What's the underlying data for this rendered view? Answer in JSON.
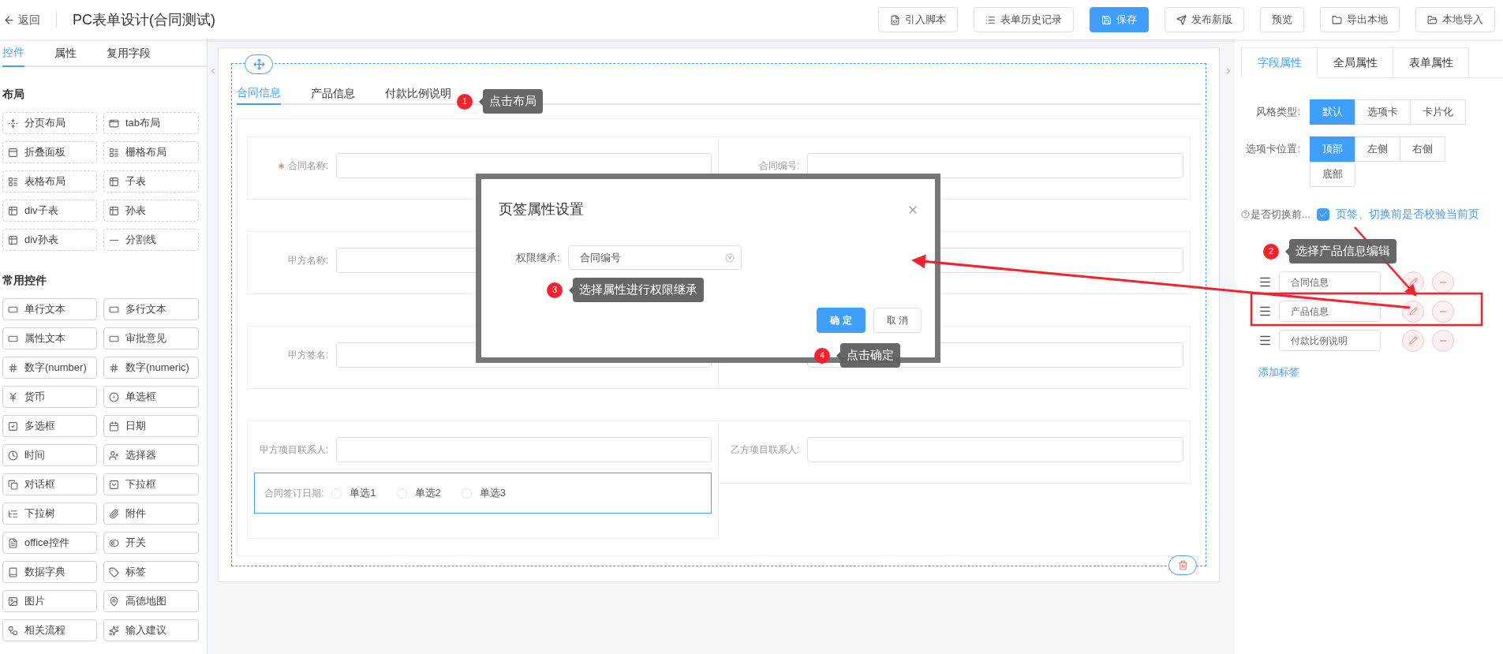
{
  "topbar": {
    "back": "返回",
    "title": "PC表单设计(合同测试)",
    "buttons": [
      {
        "label": "引入脚本",
        "primary": false
      },
      {
        "label": "表单历史记录",
        "primary": false
      },
      {
        "label": "保存",
        "primary": true
      },
      {
        "label": "发布新版",
        "primary": false
      },
      {
        "label": "预览",
        "primary": false
      },
      {
        "label": "导出本地",
        "primary": false
      },
      {
        "label": "本地导入",
        "primary": false
      }
    ]
  },
  "left_panel": {
    "tabs": [
      {
        "label": "控件",
        "selected": true
      },
      {
        "label": "属性",
        "selected": false
      },
      {
        "label": "复用字段",
        "selected": false
      }
    ],
    "groups": [
      {
        "title": "布局",
        "kind": "layout",
        "items": [
          "分页布局",
          "tab布局",
          "折叠面板",
          "栅格布局",
          "表格布局",
          "子表",
          "div子表",
          "孙表",
          "div孙表",
          "分割线"
        ]
      },
      {
        "title": "常用控件",
        "kind": "common",
        "items": [
          "单行文本",
          "多行文本",
          "属性文本",
          "审批意见",
          "数字(number)",
          "数字(numeric)",
          "货币",
          "单选框",
          "多选框",
          "日期",
          "时间",
          "选择器",
          "对话框",
          "下拉框",
          "下拉树",
          "附件",
          "office控件",
          "开关",
          "数据字典",
          "标签",
          "图片",
          "高德地图",
          "相关流程",
          "输入建议"
        ]
      }
    ]
  },
  "canvas": {
    "tabs": [
      {
        "label": "合同信息",
        "selected": true
      },
      {
        "label": "产品信息",
        "selected": false
      },
      {
        "label": "付款比例说明",
        "selected": false
      }
    ],
    "rows": [
      {
        "cells": [
          {
            "label": "合同名称:",
            "required": true
          },
          {
            "label": "合同编号:",
            "required": false
          }
        ]
      },
      {
        "cells": [
          {
            "label": "甲方名称:",
            "required": false
          },
          {}
        ]
      },
      {
        "cells": [
          {
            "label": "甲方签名:",
            "required": false
          },
          {}
        ]
      },
      {
        "cells": [
          {
            "label": "甲方项目联系人:",
            "required": false
          },
          {
            "label": "乙方项目联系人:",
            "required": false
          }
        ]
      }
    ],
    "radio_field": {
      "label": "合同签订日期:",
      "active": true,
      "options": [
        {
          "label": "单选1",
          "selected": false
        },
        {
          "label": "单选2",
          "selected": false
        },
        {
          "label": "单选3",
          "selected": false
        }
      ]
    }
  },
  "dialog": {
    "title": "页签属性设置",
    "field_label": "权限继承:",
    "value": "合同编号",
    "buttons": [
      {
        "label": "确 定",
        "primary": true
      },
      {
        "label": "取 消",
        "primary": false
      }
    ]
  },
  "right_panel": {
    "tabs": [
      {
        "label": "字段属性",
        "selected": true
      },
      {
        "label": "全局属性",
        "selected": false
      },
      {
        "label": "表单属性",
        "selected": false
      }
    ],
    "style_type": {
      "label": "风格类型:",
      "options": [
        {
          "label": "默认",
          "selected": true
        },
        {
          "label": "选项卡",
          "selected": false
        },
        {
          "label": "卡片化",
          "selected": false
        }
      ]
    },
    "tab_position": {
      "label": "选项卡位置:",
      "options": [
        {
          "label": "顶部",
          "selected": true
        },
        {
          "label": "左侧",
          "selected": false
        },
        {
          "label": "右侧",
          "selected": false
        },
        {
          "label": "底部",
          "selected": false
        }
      ]
    },
    "validate": {
      "label": "是否切换前...",
      "checked": true,
      "text": "页签、切换前是否校验当前页"
    },
    "tab_items": [
      {
        "value": "合同信息"
      },
      {
        "value": "产品信息"
      },
      {
        "value": "付款比例说明"
      }
    ],
    "add_link": "添加标签"
  },
  "annotations": [
    {
      "number": "1",
      "text": "点击布局"
    },
    {
      "number": "2",
      "text": "选择产品信息编辑"
    },
    {
      "number": "3",
      "text": "选择属性进行权限继承"
    },
    {
      "number": "4",
      "text": "点击确定"
    }
  ]
}
